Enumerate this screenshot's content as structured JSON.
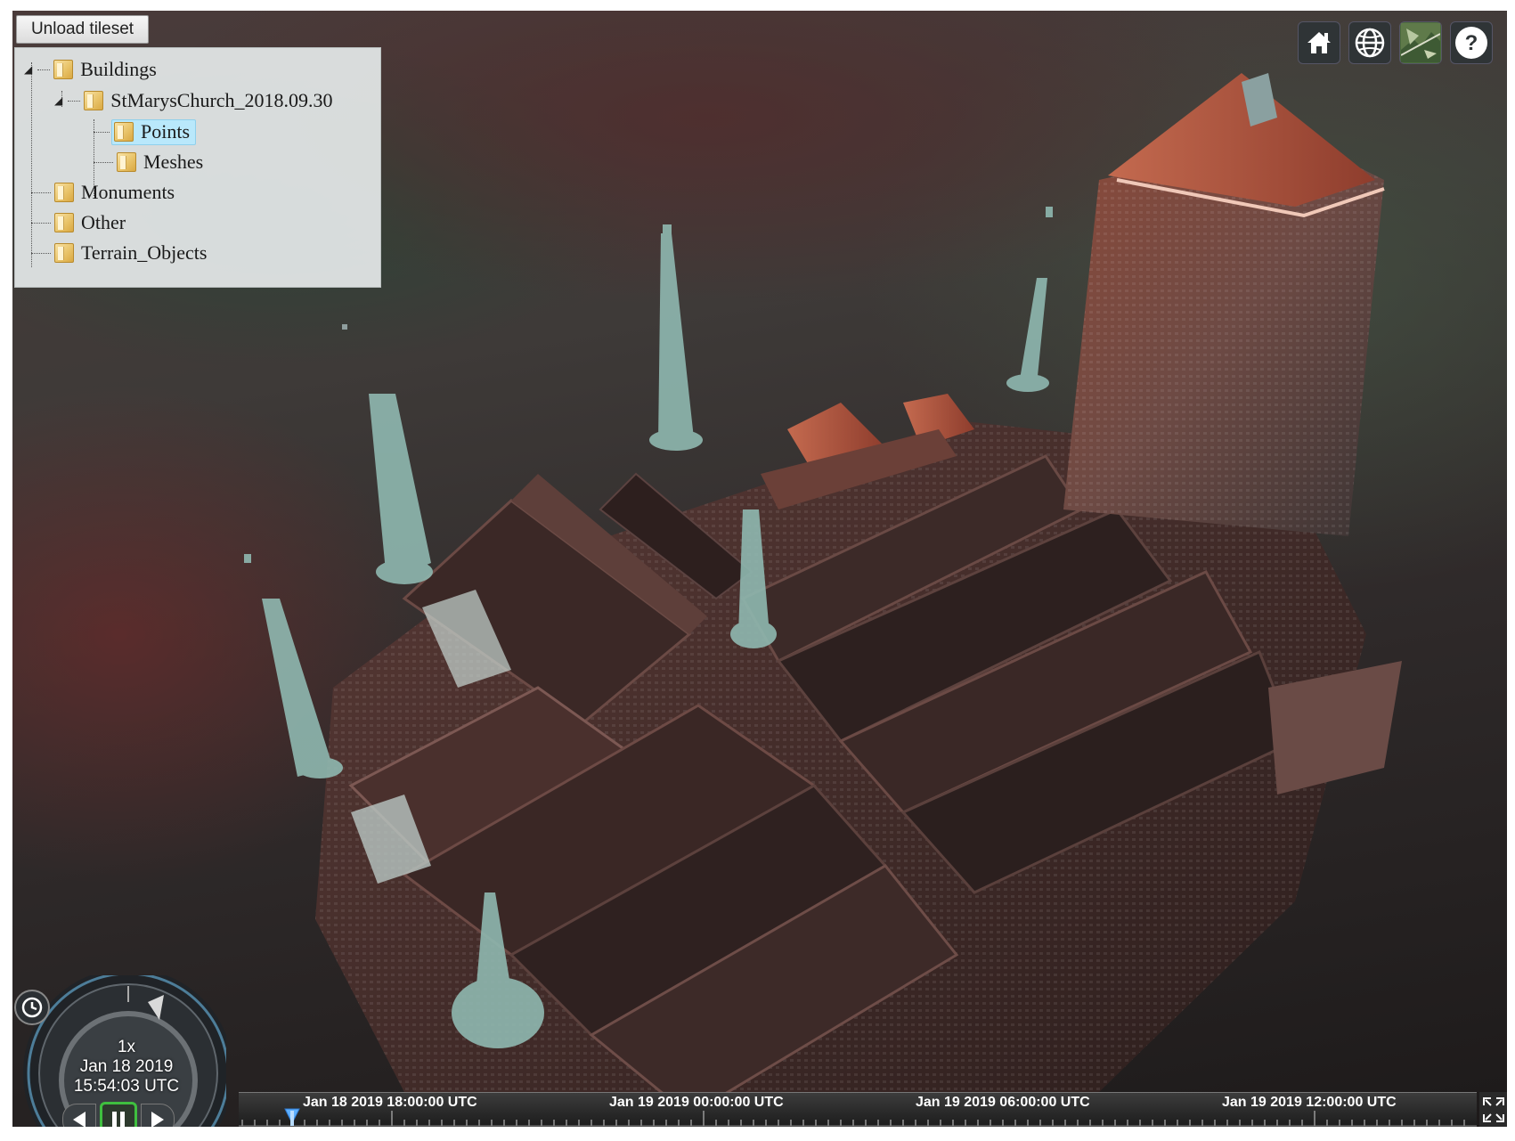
{
  "toolbar": {
    "unload_label": "Unload tileset",
    "home_icon": "home-icon",
    "globe_icon": "globe-icon",
    "imagery_icon": "imagery-layer-icon",
    "help_icon": "help-icon"
  },
  "tree": {
    "items": [
      {
        "label": "Buildings",
        "level": 0,
        "expanded": true
      },
      {
        "label": "StMarysChurch_2018.09.30",
        "level": 1,
        "expanded": true
      },
      {
        "label": "Points",
        "level": 2,
        "selected": true
      },
      {
        "label": "Meshes",
        "level": 2
      },
      {
        "label": "Monuments",
        "level": 0
      },
      {
        "label": "Other",
        "level": 0
      },
      {
        "label": "Terrain_Objects",
        "level": 0
      }
    ]
  },
  "animation": {
    "speed": "1x",
    "date": "Jan 18 2019",
    "time": "15:54:03 UTC",
    "state": "paused-button-active"
  },
  "timeline": {
    "labels": [
      "Jan 18 2019 18:00:00 UTC",
      "Jan 19 2019 00:00:00 UTC",
      "Jan 19 2019 06:00:00 UTC",
      "Jan 19 2019 12:00:00 UTC"
    ]
  },
  "colors": {
    "accent_green": "#3fbf3f",
    "selection_blue": "#b9e8fb",
    "roof_red": "#b5523a",
    "spire_teal": "#8fb8b0"
  }
}
